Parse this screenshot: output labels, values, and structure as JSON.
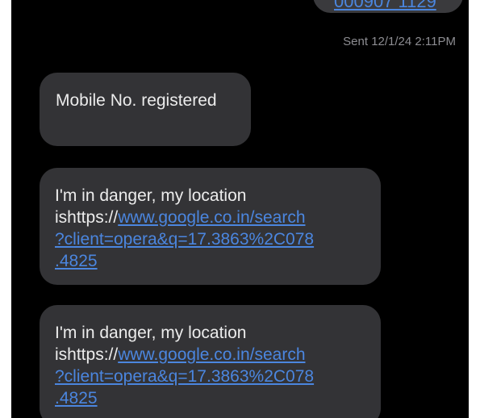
{
  "conversation": {
    "sent_message": {
      "visible_link_fragment": "000907 1129",
      "status": "Sent 12/1/24 2:11PM"
    },
    "received_messages": [
      {
        "text": "Mobile No. registered"
      },
      {
        "prefix": "I'm in danger, my location",
        "prefix2": "ishttps://",
        "link_line1": "www.google.co.in/search",
        "link_line2": "?client=opera&q=17.3863%2C078",
        "link_line3": ".4825"
      },
      {
        "prefix": "I'm in danger, my location",
        "prefix2": "ishttps://",
        "link_line1": "www.google.co.in/search",
        "link_line2": "?client=opera&q=17.3863%2C078",
        "link_line3": ".4825"
      }
    ]
  },
  "colors": {
    "background": "#000000",
    "bubble": "#333336",
    "link": "#4b86df",
    "text": "#ececec",
    "status": "#8d8d92"
  }
}
